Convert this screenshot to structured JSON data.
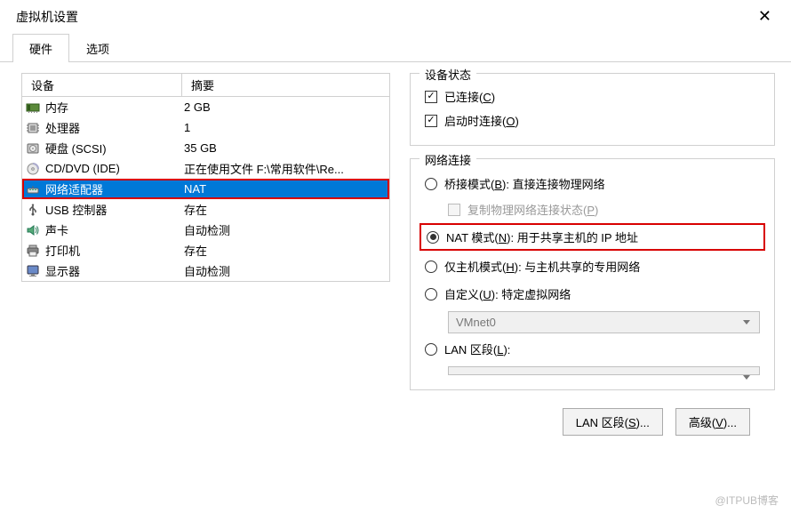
{
  "window": {
    "title": "虚拟机设置"
  },
  "tabs": {
    "hardware": "硬件",
    "options": "选项"
  },
  "device_table": {
    "headers": {
      "device": "设备",
      "summary": "摘要"
    },
    "rows": [
      {
        "name": "内存",
        "summary": "2 GB",
        "icon": "memory-icon"
      },
      {
        "name": "处理器",
        "summary": "1",
        "icon": "cpu-icon"
      },
      {
        "name": "硬盘 (SCSI)",
        "summary": "35 GB",
        "icon": "disk-icon"
      },
      {
        "name": "CD/DVD (IDE)",
        "summary": "正在使用文件 F:\\常用软件\\Re...",
        "icon": "cd-icon"
      },
      {
        "name": "网络适配器",
        "summary": "NAT",
        "icon": "network-icon",
        "selected": true
      },
      {
        "name": "USB 控制器",
        "summary": "存在",
        "icon": "usb-icon"
      },
      {
        "name": "声卡",
        "summary": "自动检测",
        "icon": "sound-icon"
      },
      {
        "name": "打印机",
        "summary": "存在",
        "icon": "printer-icon"
      },
      {
        "name": "显示器",
        "summary": "自动检测",
        "icon": "display-icon"
      }
    ]
  },
  "device_status": {
    "legend": "设备状态",
    "connected": "已连接(C)",
    "connect_at_power": "启动时连接(O)"
  },
  "network": {
    "legend": "网络连接",
    "bridge": "桥接模式(B): 直接连接物理网络",
    "replicate": "复制物理网络连接状态(P)",
    "nat": "NAT 模式(N): 用于共享主机的 IP 地址",
    "hostonly": "仅主机模式(H): 与主机共享的专用网络",
    "custom": "自定义(U): 特定虚拟网络",
    "custom_value": "VMnet0",
    "lan": "LAN 区段(L):",
    "lan_value": ""
  },
  "buttons": {
    "lan_segments": "LAN 区段(S)...",
    "advanced": "高级(V)..."
  },
  "watermark": "@ITPUB博客"
}
